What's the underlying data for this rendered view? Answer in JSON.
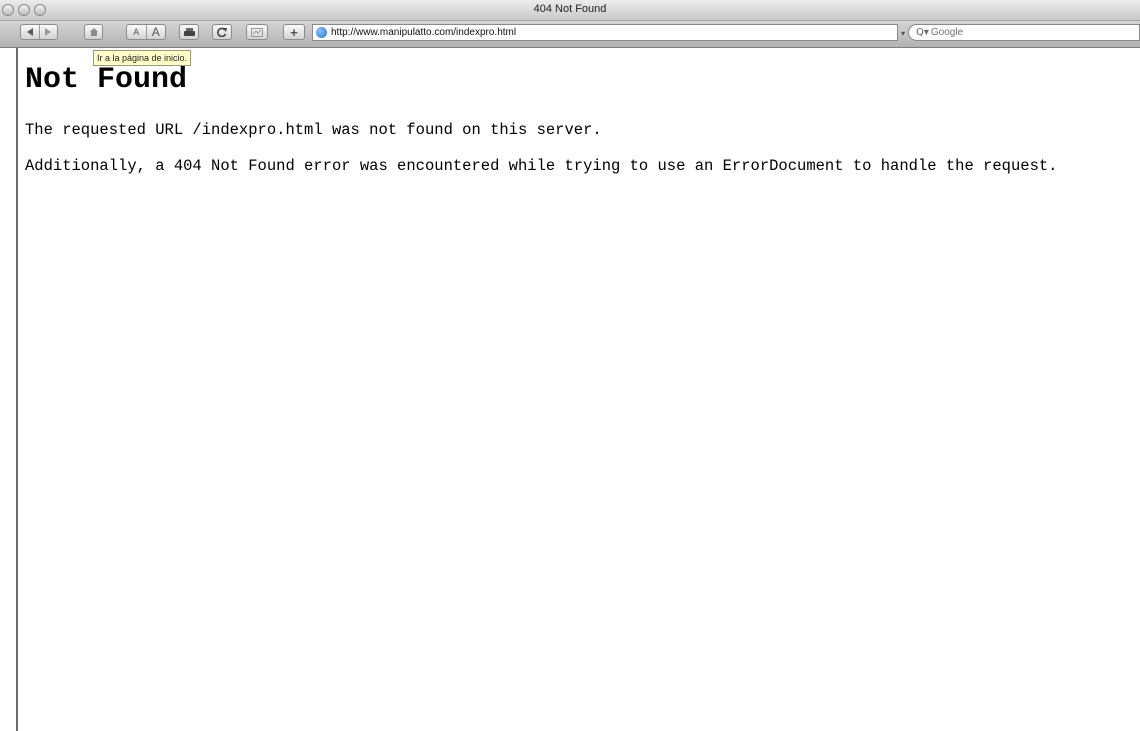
{
  "window": {
    "title": "404 Not Found"
  },
  "toolbar": {
    "back_icon": "back-arrow-icon",
    "forward_icon": "forward-arrow-icon",
    "home_icon": "home-icon",
    "text_smaller_label": "A",
    "text_bigger_label": "A",
    "print_icon": "printer-icon",
    "reload_icon": "reload-icon",
    "bug_icon": "bug-report-icon",
    "add_bookmark_label": "+",
    "url": "http://www.manipulatto.com/indexpro.html",
    "search_placeholder": "Google"
  },
  "tooltip": {
    "text": "Ir a la página de inicio."
  },
  "page": {
    "heading": "Not Found",
    "paragraph1": "The requested URL /indexpro.html was not found on this server.",
    "paragraph2": "Additionally, a 404 Not Found error was encountered while trying to use an ErrorDocument to handle the request."
  },
  "colors": {
    "tooltip_bg": "#ffffc8",
    "toolbar_bg": "#c4c4c4",
    "globe": "#1f6fd1"
  }
}
